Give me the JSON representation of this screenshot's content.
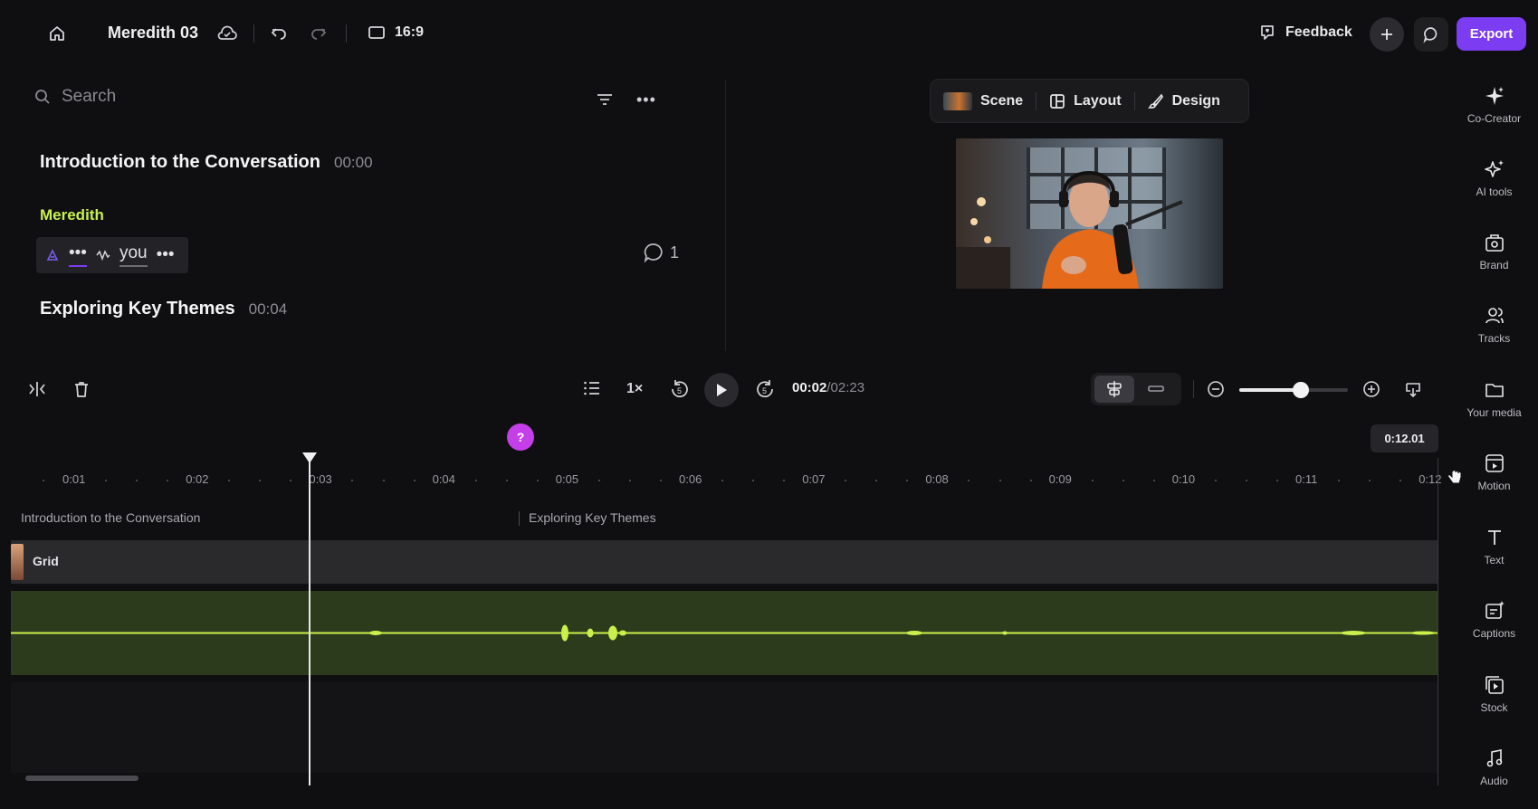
{
  "header": {
    "project_title": "Meredith 03",
    "aspect_ratio": "16:9",
    "feedback_label": "Feedback",
    "export_label": "Export",
    "accent_color": "#7b3cf2"
  },
  "script": {
    "search_placeholder": "Search",
    "sections": [
      {
        "title": "Introduction to the Conversation",
        "time": "00:00"
      },
      {
        "title": "Exploring Key Themes",
        "time": "00:04"
      }
    ],
    "speaker": "Meredith",
    "speaker_color": "#c9f04b",
    "words": [
      "•••",
      "you",
      "•••"
    ],
    "comment_count": "1"
  },
  "preview_tabs": [
    "Scene",
    "Layout",
    "Design"
  ],
  "rail": [
    {
      "label": "Co-Creator",
      "icon": "sparkle-icon"
    },
    {
      "label": "AI tools",
      "icon": "magic-sparkles-icon"
    },
    {
      "label": "Brand",
      "icon": "brand-kit-icon"
    },
    {
      "label": "Tracks",
      "icon": "people-icon"
    },
    {
      "label": "Your media",
      "icon": "folder-icon"
    },
    {
      "label": "Motion",
      "icon": "motion-icon"
    },
    {
      "label": "Text",
      "icon": "text-icon"
    },
    {
      "label": "Captions",
      "icon": "captions-icon"
    },
    {
      "label": "Stock",
      "icon": "stock-media-icon"
    },
    {
      "label": "Audio",
      "icon": "music-note-icon"
    }
  ],
  "playback": {
    "speed": "1×",
    "skip_back": "5",
    "skip_forward": "5",
    "current_time": "00:02",
    "duration": "/02:23",
    "zoom_level": 0.57
  },
  "timeline": {
    "ruler": [
      "0:01",
      "0:02",
      "0:03",
      "0:04",
      "0:05",
      "0:06",
      "0:07",
      "0:08",
      "0:09",
      "0:10",
      "0:11",
      "0:12"
    ],
    "hover_time": "0:12.01",
    "help_label": "?",
    "section_labels": [
      "Introduction to the Conversation",
      "Exploring Key Themes"
    ],
    "video_track_label": "Grid",
    "waveform_color": "#c9f04b"
  }
}
